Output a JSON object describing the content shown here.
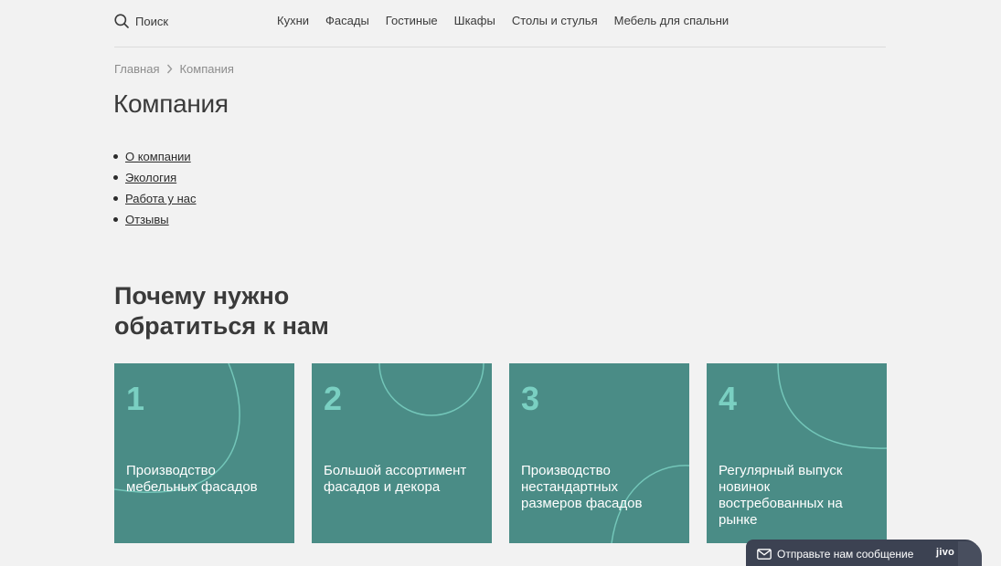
{
  "header": {
    "search_label": "Поиск",
    "nav": [
      "Кухни",
      "Фасады",
      "Гостиные",
      "Шкафы",
      "Столы и стулья",
      "Мебель для спальни"
    ]
  },
  "breadcrumb": {
    "home": "Главная",
    "current": "Компания"
  },
  "page": {
    "title": "Компания"
  },
  "submenu": [
    "О компании",
    "Экология",
    "Работа у нас",
    "Отзывы"
  ],
  "why": {
    "title": "Почему нужно обратиться к нам",
    "cards": [
      {
        "num": "1",
        "text": "Производство мебельных фасадов"
      },
      {
        "num": "2",
        "text": "Большой ассортимент фасадов и декора"
      },
      {
        "num": "3",
        "text": "Производство нестандартных размеров фасадов"
      },
      {
        "num": "4",
        "text": "Регулярный выпуск новинок востребованных на рынке"
      }
    ]
  },
  "chat": {
    "label": "Отправьте нам сообщение",
    "logo": "jivo"
  },
  "colors": {
    "card_bg": "#4a8c86",
    "card_number": "#7ad0c2",
    "chat_bg": "#3c4252",
    "page_bg": "#f2f2f2"
  }
}
